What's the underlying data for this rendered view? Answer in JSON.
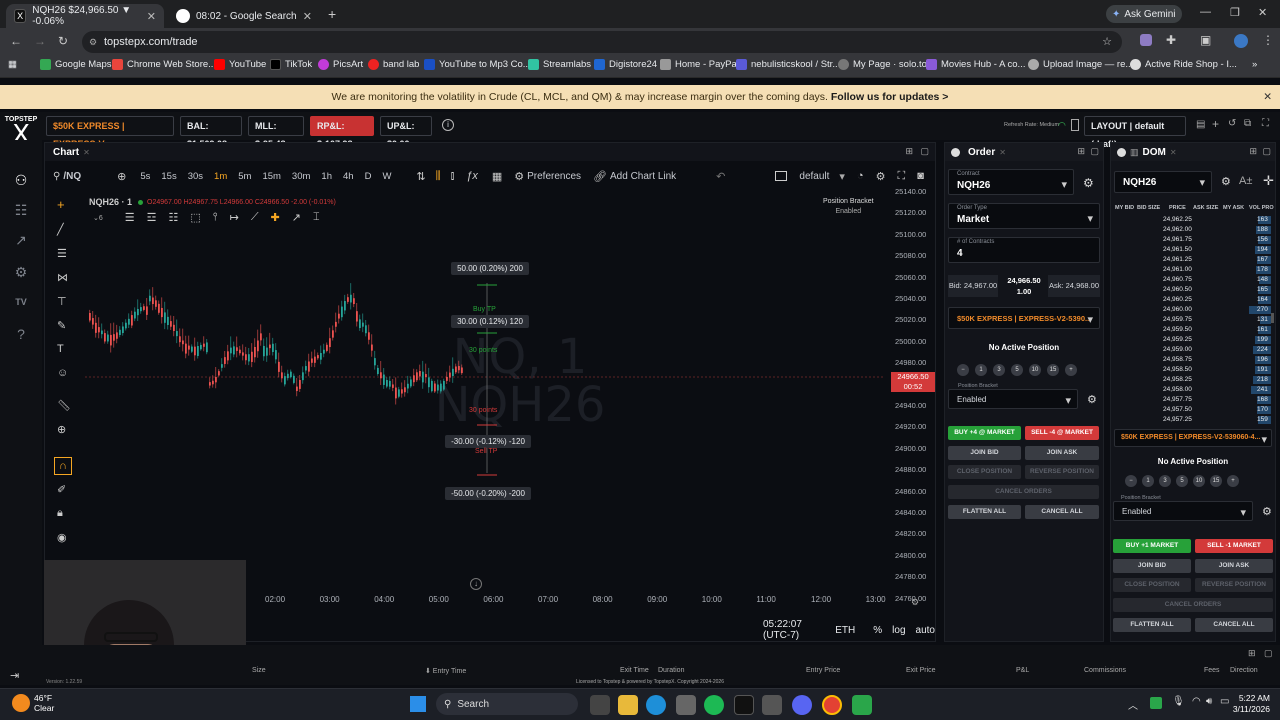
{
  "browser": {
    "tabs": [
      {
        "title": "NQH26 $24,966.50 ▼ -0.06%",
        "active": true
      },
      {
        "title": "08:02 - Google Search",
        "active": false
      }
    ],
    "ask_gemini": "Ask Gemini",
    "url": "topstepx.com/trade",
    "bookmarks": [
      "Google Maps",
      "Chrome Web Store...",
      "YouTube",
      "TikTok",
      "PicsArt",
      "band lab",
      "YouTube to Mp3 Co...",
      "Streamlabs",
      "Digistore24",
      "Home - PayPal",
      "nebulisticskool / Str...",
      "My Page · solo.to",
      "Movies Hub - A co...",
      "Upload Image — re...",
      "Active Ride Shop - I..."
    ]
  },
  "banner": {
    "text": "We are monitoring the volatility in Crude (CL, MCL, and QM) & may increase margin over the coming days.",
    "link": "Follow us for updates >"
  },
  "appbar": {
    "logo_top": "TOPSTEP",
    "logo_x": "X",
    "account": "$50K EXPRESS | EXPRESS-V...",
    "bal": "BAL: $1,509.08",
    "mll": "MLL: $-95.48",
    "rpl": "RP&L: $-107.98",
    "upl": "UP&L: $0.00",
    "refresh": "Refresh Rate: Medium",
    "layout": "LAYOUT | default (draft)"
  },
  "chart": {
    "panel_title": "Chart",
    "symbol_search": "/NQ",
    "intervals": [
      "5s",
      "15s",
      "30s",
      "1m",
      "5m",
      "15m",
      "30m",
      "1h",
      "4h",
      "D",
      "W"
    ],
    "active_interval": "1m",
    "preferences": "Preferences",
    "add_chart_link": "Add Chart Link",
    "template": "default",
    "legend_symbol": "NQH26 · 1",
    "legend_values": "O24967.00 H24967.75 L24966.00 C24966.50 -2.00 (-0.01%)",
    "watermark_top": "NQ, 1",
    "watermark_bottom": "NQH26",
    "position_bracket": "Position Bracket",
    "position_bracket_state": "Enabled",
    "y_ticks": [
      "25140.00",
      "25120.00",
      "25100.00",
      "25080.00",
      "25060.00",
      "25040.00",
      "25020.00",
      "25000.00",
      "24980.00",
      "24960.00",
      "24940.00",
      "24920.00",
      "24900.00",
      "24880.00",
      "24860.00",
      "24840.00",
      "24820.00",
      "24800.00",
      "24780.00",
      "24760.00"
    ],
    "x_ticks": [
      "02:00",
      "03:00",
      "04:00",
      "05:00",
      "06:00",
      "07:00",
      "08:00",
      "09:00",
      "10:00",
      "11:00",
      "12:00",
      "13:00"
    ],
    "price_label": "24966.50",
    "price_timer": "00:52",
    "bracket": {
      "tp_top": "50.00 (0.20%) 200",
      "buy_tp": "Buy TP",
      "tp_mid": "30.00 (0.12%) 120",
      "points_up": "30 points",
      "points_down": "30 points",
      "sl_mid": "-30.00 (-0.12%) -120",
      "sell_tp": "Sell TP",
      "sl_bottom": "-50.00 (-0.20%) -200"
    },
    "clock": "05:22:07 (UTC-7)",
    "session": "ETH",
    "pct": "%",
    "log": "log",
    "auto": "auto",
    "version": "Version: 1.22.59"
  },
  "order": {
    "title": "Order",
    "contract_label": "Contract",
    "contract": "NQH26",
    "order_type_label": "Order Type",
    "order_type": "Market",
    "contracts_label": "# of Contracts",
    "contracts": "4",
    "bid": "Bid: 24,967.00",
    "last": "24,966.50",
    "last_size": "1.00",
    "ask": "Ask: 24,968.00",
    "account": "$50K EXPRESS | EXPRESS-V2-5390...",
    "no_position": "No Active Position",
    "qty_buttons": [
      "1",
      "3",
      "5",
      "10",
      "15"
    ],
    "bracket_label": "Position Bracket",
    "bracket_value": "Enabled",
    "buy_market": "BUY +4 @ MARKET",
    "sell_market": "SELL -4 @ MARKET",
    "join_bid": "JOIN BID",
    "join_ask": "JOIN ASK",
    "close_position": "CLOSE POSITION",
    "reverse_position": "REVERSE POSITION",
    "cancel_orders": "CANCEL ORDERS",
    "flatten_all": "FLATTEN ALL",
    "cancel_all": "CANCEL ALL"
  },
  "dom": {
    "title": "DOM",
    "contract": "NQH26",
    "columns": [
      "MY BID",
      "BID SIZE",
      "PRICE",
      "ASK SIZE",
      "MY ASK",
      "VOL PRO"
    ],
    "rows": [
      {
        "price": "24,962.25",
        "vol": "163"
      },
      {
        "price": "24,962.00",
        "vol": "188"
      },
      {
        "price": "24,961.75",
        "vol": "156"
      },
      {
        "price": "24,961.50",
        "vol": "194"
      },
      {
        "price": "24,961.25",
        "vol": "167"
      },
      {
        "price": "24,961.00",
        "vol": "178"
      },
      {
        "price": "24,960.75",
        "vol": "148"
      },
      {
        "price": "24,960.50",
        "vol": "165"
      },
      {
        "price": "24,960.25",
        "vol": "164"
      },
      {
        "price": "24,960.00",
        "vol": "270"
      },
      {
        "price": "24,959.75",
        "vol": "131"
      },
      {
        "price": "24,959.50",
        "vol": "161"
      },
      {
        "price": "24,959.25",
        "vol": "199"
      },
      {
        "price": "24,959.00",
        "vol": "224"
      },
      {
        "price": "24,958.75",
        "vol": "196"
      },
      {
        "price": "24,958.50",
        "vol": "191"
      },
      {
        "price": "24,958.25",
        "vol": "218"
      },
      {
        "price": "24,958.00",
        "vol": "241"
      },
      {
        "price": "24,957.75",
        "vol": "168"
      },
      {
        "price": "24,957.50",
        "vol": "170"
      },
      {
        "price": "24,957.25",
        "vol": "159"
      }
    ],
    "account": "$50K EXPRESS | EXPRESS-V2-539060-4...",
    "no_position": "No Active Position",
    "qty_buttons": [
      "1",
      "3",
      "5",
      "10",
      "15"
    ],
    "bracket_label": "Position Bracket",
    "bracket_value": "Enabled",
    "buy_market": "BUY +1 MARKET",
    "sell_market": "SELL -1 MARKET",
    "join_bid": "JOIN BID",
    "join_ask": "JOIN ASK",
    "close_position": "CLOSE POSITION",
    "reverse_position": "REVERSE POSITION",
    "cancel_orders": "CANCEL ORDERS",
    "flatten_all": "FLATTEN ALL",
    "cancel_all": "CANCEL ALL"
  },
  "positions_header": [
    "Size",
    "Entry Time",
    "Exit Time",
    "Duration",
    "Entry Price",
    "Exit Price",
    "P&L",
    "Commissions",
    "Fees",
    "Direction"
  ],
  "license": "Licensed to Topstep & powered by TopstepX. Copyright 2024-2026",
  "taskbar": {
    "temp": "46°F",
    "weather": "Clear",
    "search": "Search",
    "time": "5:22 AM",
    "date": "3/11/2026"
  }
}
